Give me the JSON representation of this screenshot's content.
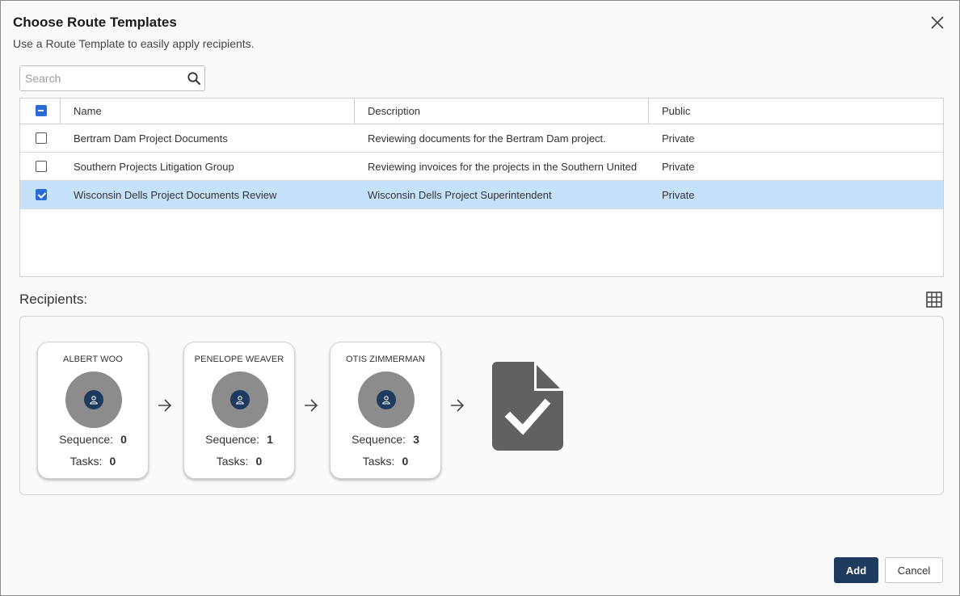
{
  "dialog": {
    "title": "Choose Route Templates",
    "subtitle": "Use a Route Template to easily apply recipients.",
    "close_icon": "close-icon"
  },
  "search": {
    "placeholder": "Search",
    "value": "",
    "icon": "search-icon"
  },
  "table": {
    "headers": {
      "name": "Name",
      "description": "Description",
      "public": "Public"
    },
    "select_all_state": "indeterminate",
    "rows": [
      {
        "name": "Bertram Dam Project Documents",
        "description": "Reviewing documents for the Bertram Dam project.",
        "public": "Private",
        "checked": false
      },
      {
        "name": "Southern Projects Litigation Group",
        "description": "Reviewing invoices for the projects in the Southern United…",
        "public": "Private",
        "checked": false
      },
      {
        "name": "Wisconsin Dells Project Documents Review",
        "description": "Wisconsin Dells Project Superintendent",
        "public": "Private",
        "checked": true
      }
    ]
  },
  "recipients": {
    "label": "Recipients:",
    "view_toggle_icon": "grid-icon",
    "sequence_label": "Sequence:",
    "tasks_label": "Tasks:",
    "list": [
      {
        "name": "ALBERT WOO",
        "sequence": "0",
        "tasks": "0"
      },
      {
        "name": "PENELOPE WEAVER",
        "sequence": "1",
        "tasks": "0"
      },
      {
        "name": "OTIS ZIMMERMAN",
        "sequence": "3",
        "tasks": "0"
      }
    ],
    "arrow_icon": "arrow-right-icon",
    "final_icon": "document-check-icon"
  },
  "footer": {
    "add_label": "Add",
    "cancel_label": "Cancel"
  },
  "colors": {
    "primary": "#1e3a5f",
    "selected_row": "#c6e2fb",
    "checkbox": "#2d6bd8",
    "avatar_bg": "#8c8c8c",
    "doc_icon": "#616161"
  }
}
